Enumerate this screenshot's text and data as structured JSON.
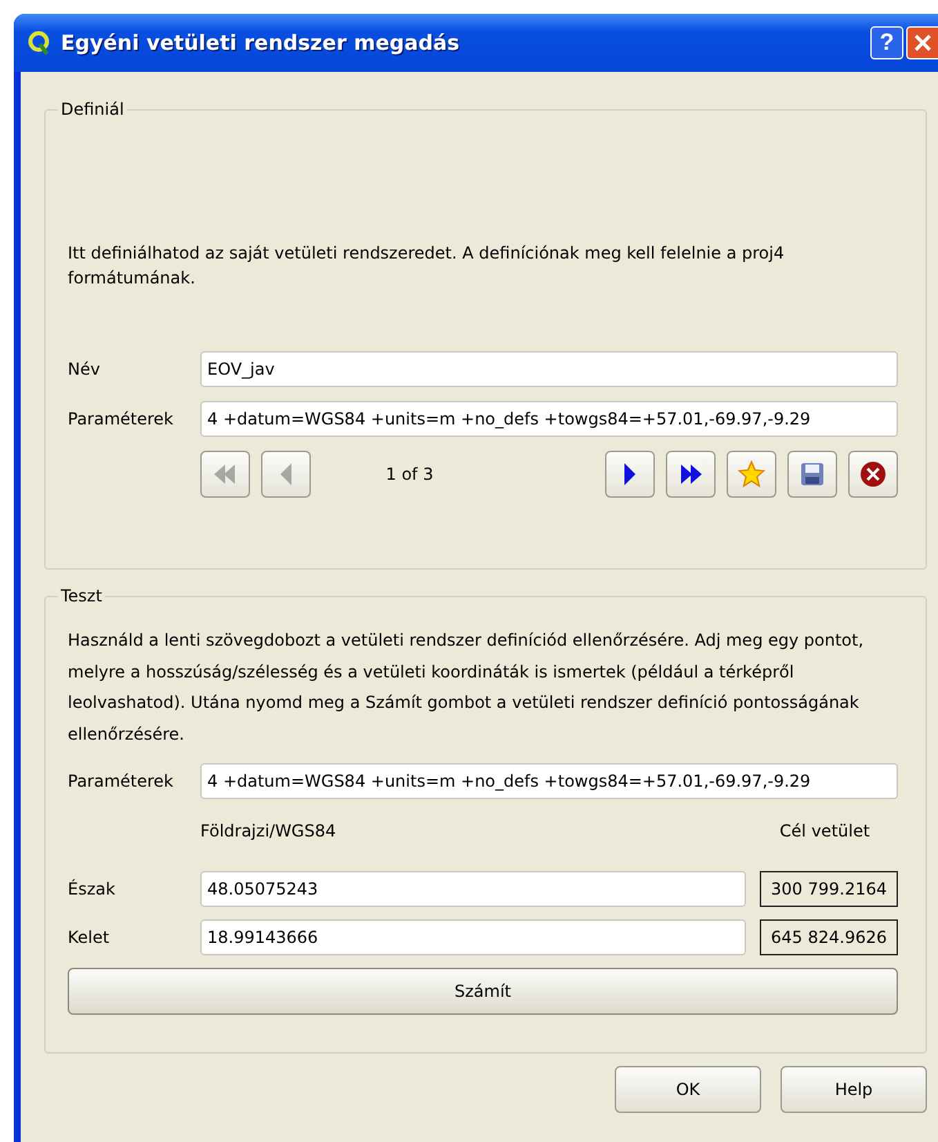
{
  "window": {
    "title": "Egyéni vetületi rendszer megadás",
    "help_glyph": "?"
  },
  "define": {
    "legend": "Definiál",
    "description": "Itt definiálhatod az saját vetületi rendszeredet. A definíciónak meg kell felelnie a proj4 formátumának.",
    "name_label": "Név",
    "name_value": "EOV_jav",
    "params_label": "Paraméterek",
    "params_value": "4 +datum=WGS84 +units=m +no_defs +towgs84=+57.01,-69.97,-9.29",
    "counter": "1 of 3",
    "nav_buttons": [
      {
        "kind": "first",
        "disabled": true
      },
      {
        "kind": "prev",
        "disabled": true
      },
      {
        "kind": "next",
        "disabled": false
      },
      {
        "kind": "last",
        "disabled": false
      },
      {
        "kind": "new",
        "disabled": false
      },
      {
        "kind": "save",
        "disabled": false
      },
      {
        "kind": "delete",
        "disabled": false
      }
    ]
  },
  "test": {
    "legend": "Teszt",
    "description": "Használd a lenti szövegdobozt a vetületi rendszer definíciód ellenőrzésére. Adj meg egy pontot, melyre a hosszúság/szélesség és a vetületi koordináták is ismertek (például a térképről leolvashatod). Utána nyomd meg a Számít gombot a vetületi rendszer definíció pontosságának ellenőrzésére.",
    "params_label": "Paraméterek",
    "params_value": "4 +datum=WGS84 +units=m +no_defs +towgs84=+57.01,-69.97,-9.29",
    "geo_header": "Földrajzi/WGS84",
    "target_header": "Cél vetület",
    "rows": [
      {
        "label": "Észak",
        "value": "48.05075243",
        "result": "300 799.2164"
      },
      {
        "label": "Kelet",
        "value": "18.99143666",
        "result": "645 824.9626"
      }
    ],
    "calc_button": "Számít"
  },
  "buttons": [
    "OK",
    "Help"
  ]
}
